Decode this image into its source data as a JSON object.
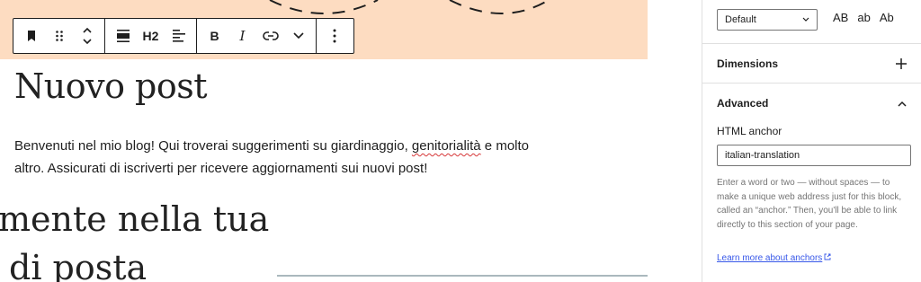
{
  "toolbar": {
    "heading_level_label": "H2",
    "bold_label": "B",
    "italic_label": "I"
  },
  "post": {
    "title": "Nuovo post",
    "intro_before": "Benvenuti nel mio blog! Qui troverai suggerimenti su giardinaggio, ",
    "intro_misspelled": "genitorialità",
    "intro_after": " e molto altro. Assicurati di iscriverti per ricevere aggiornamenti sui nuovi post!",
    "heading_line1": "mente nella tua",
    "heading_line2": "di posta"
  },
  "sidebar": {
    "font_select_value": "Default",
    "letter_case": [
      "AB",
      "ab",
      "Ab"
    ],
    "dimensions_title": "Dimensions",
    "advanced_title": "Advanced",
    "html_anchor_label": "HTML anchor",
    "html_anchor_value": "italian-translation",
    "help_text": "Enter a word or two — without spaces — to make a unique web address just for this block, called an “anchor.” Then, you'll be able to link directly to this section of your page.",
    "learn_more_link": "Learn more about anchors"
  },
  "colors": {
    "header_background": "#fddcc1",
    "link": "#3858e9",
    "spellcheck": "#d63638"
  }
}
